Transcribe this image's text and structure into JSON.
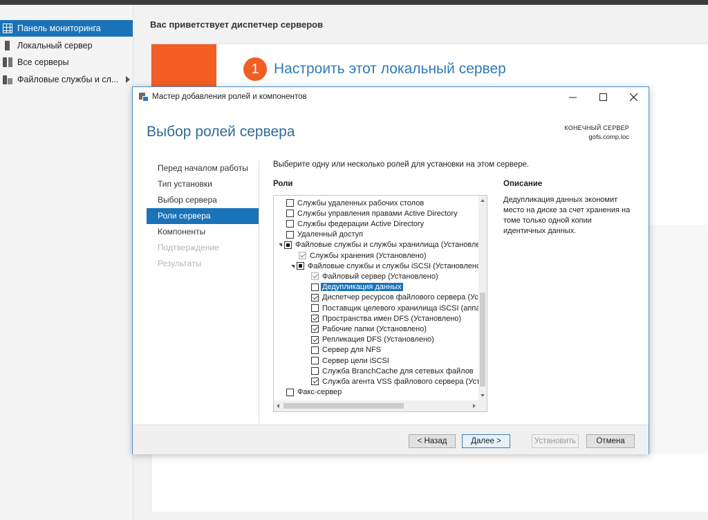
{
  "server_manager": {
    "nav": [
      {
        "label": "Панель мониторинга",
        "icon": "dashboard-icon",
        "active": true
      },
      {
        "label": "Локальный сервер",
        "icon": "server-icon"
      },
      {
        "label": "Все серверы",
        "icon": "servers-icon"
      },
      {
        "label": "Файловые службы и сл...",
        "icon": "file-services-icon"
      }
    ],
    "welcome_title": "Вас приветствует диспетчер серверов",
    "step_number": "1",
    "step_text": "Настроить этот локальный сервер"
  },
  "wizard": {
    "title": "Мастер добавления ролей и компонентов",
    "heading": "Выбор ролей сервера",
    "destination_label": "КОНЕЧНЫЙ СЕРВЕР",
    "destination_server": "gofs.comp.loc",
    "steps": [
      {
        "label": "Перед началом работы",
        "state": "normal"
      },
      {
        "label": "Тип установки",
        "state": "normal"
      },
      {
        "label": "Выбор сервера",
        "state": "normal"
      },
      {
        "label": "Роли сервера",
        "state": "active"
      },
      {
        "label": "Компоненты",
        "state": "normal"
      },
      {
        "label": "Подтверждение",
        "state": "disabled"
      },
      {
        "label": "Результаты",
        "state": "disabled"
      }
    ],
    "instruction": "Выберите одну или несколько ролей для установки на этом сервере.",
    "roles_label": "Роли",
    "description_label": "Описание",
    "description_text": "Дедупликация данных экономит место на диске за счет хранения на томе только одной копии идентичных данных.",
    "roles": [
      {
        "label": "Службы удаленных рабочих столов",
        "level": 0,
        "state": "unchecked"
      },
      {
        "label": "Службы управления правами Active Directory",
        "level": 0,
        "state": "unchecked"
      },
      {
        "label": "Службы федерации Active Directory",
        "level": 0,
        "state": "unchecked"
      },
      {
        "label": "Удаленный доступ",
        "level": 0,
        "state": "unchecked"
      },
      {
        "label": "Файловые службы и службы хранилища (Установлено)",
        "level": 0,
        "state": "partial",
        "expander": true
      },
      {
        "label": "Службы хранения (Установлено)",
        "level": 1,
        "state": "checked-disabled"
      },
      {
        "label": "Файловые службы и службы iSCSI (Установлено)",
        "level": 1,
        "state": "partial",
        "expander": true
      },
      {
        "label": "Файловый сервер (Установлено)",
        "level": 2,
        "state": "checked-disabled"
      },
      {
        "label": "Дедупликация данных",
        "level": 2,
        "state": "unchecked",
        "selected": true
      },
      {
        "label": "Диспетчер ресурсов файлового сервера (Установлено)",
        "level": 2,
        "state": "checked"
      },
      {
        "label": "Поставщик целевого хранилища iSCSI (аппаратные поставщики)",
        "level": 2,
        "state": "unchecked"
      },
      {
        "label": "Пространства имен DFS (Установлено)",
        "level": 2,
        "state": "checked"
      },
      {
        "label": "Рабочие папки (Установлено)",
        "level": 2,
        "state": "checked"
      },
      {
        "label": "Репликация DFS (Установлено)",
        "level": 2,
        "state": "checked"
      },
      {
        "label": "Сервер для NFS",
        "level": 2,
        "state": "unchecked"
      },
      {
        "label": "Сервер цели iSCSI",
        "level": 2,
        "state": "unchecked"
      },
      {
        "label": "Служба BranchCache для сетевых файлов",
        "level": 2,
        "state": "unchecked"
      },
      {
        "label": "Служба агента VSS файлового сервера (Установлено)",
        "level": 2,
        "state": "checked"
      },
      {
        "label": "Факс-сервер",
        "level": 0,
        "state": "unchecked"
      }
    ],
    "buttons": {
      "back": "< Назад",
      "next": "Далее >",
      "install": "Установить",
      "cancel": "Отмена"
    }
  },
  "colors": {
    "accent": "#1a73b8",
    "orange": "#f25e23",
    "heading": "#2e6b94"
  }
}
